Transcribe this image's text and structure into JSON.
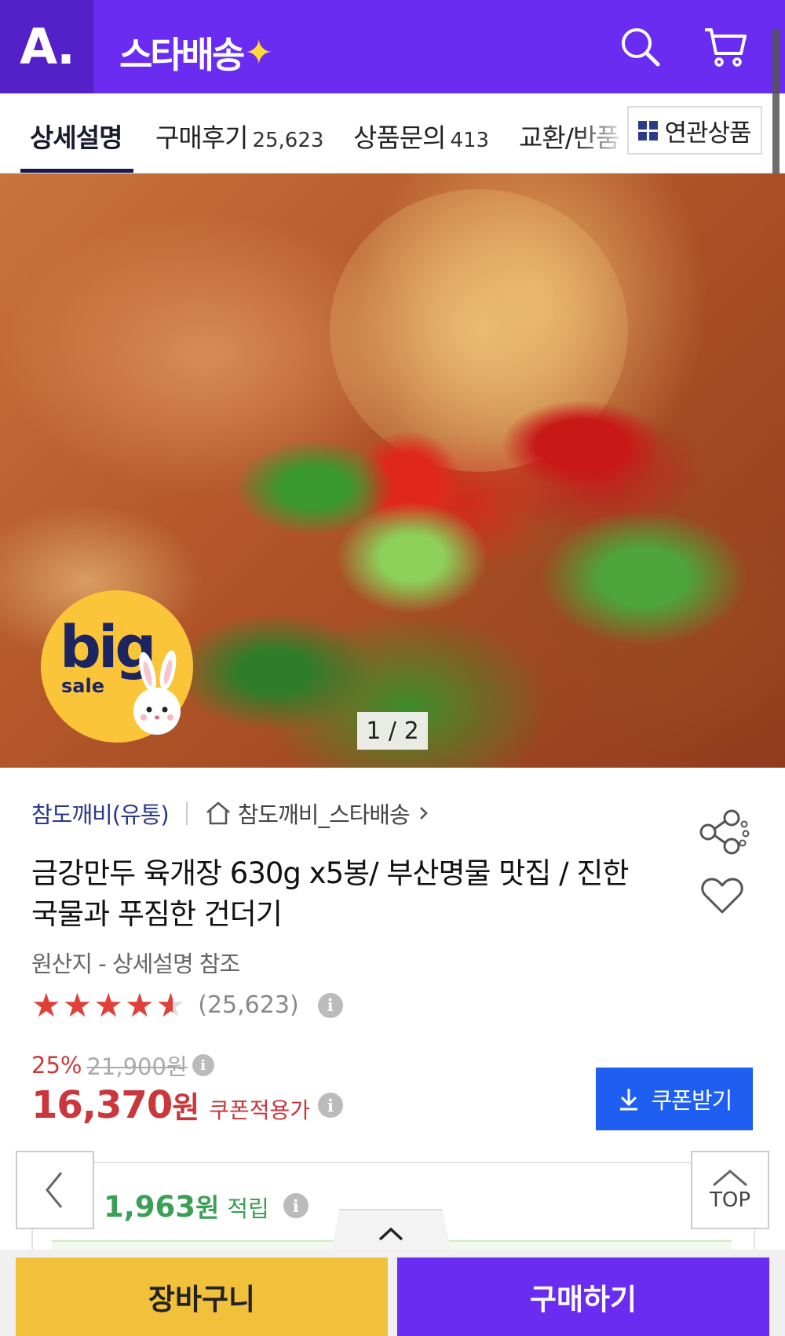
{
  "header": {
    "logo": "A.",
    "brand": "스타배송",
    "brand_star": "✦"
  },
  "tabs": [
    {
      "label": "상세설명",
      "count": ""
    },
    {
      "label": "구매후기",
      "count": "25,623"
    },
    {
      "label": "상품문의",
      "count": "413"
    },
    {
      "label": "교환/반품",
      "count": ""
    }
  ],
  "related_label": "연관상품",
  "hero": {
    "counter": "1 / 2",
    "badge_big": "big",
    "badge_sale": "sale"
  },
  "product": {
    "seller": "참도깨비(유통)",
    "store": "참도깨비_스타배송",
    "title": "금강만두 육개장 630g x5봉/ 부산명물 맛집 / 진한국물과 푸짐한 건더기",
    "origin": "원산지 - 상세설명 참조",
    "rating_value": 4.6,
    "review_count": "(25,623)",
    "discount": "25%",
    "original_price": "21,900원",
    "price": "16,370",
    "price_unit": "원",
    "coupon_price_label": "쿠폰적용가",
    "coupon_button": "쿠폰받기",
    "points": "1,963",
    "points_unit": "원",
    "points_label": "적립"
  },
  "nav": {
    "top_label": "TOP"
  },
  "bottom": {
    "cart_label": "장바구니",
    "buy_label": "구매하기"
  },
  "colors": {
    "brand_purple": "#6a2cf0",
    "price_red": "#c9363b",
    "coupon_blue": "#1e5ef0",
    "cart_yellow": "#f2c13c",
    "points_green": "#3aa055"
  },
  "icons": [
    "search-icon",
    "cart-icon",
    "share-icon",
    "heart-icon",
    "info-icon",
    "download-icon",
    "chevron-left-icon",
    "chevron-up-icon",
    "home-icon"
  ]
}
